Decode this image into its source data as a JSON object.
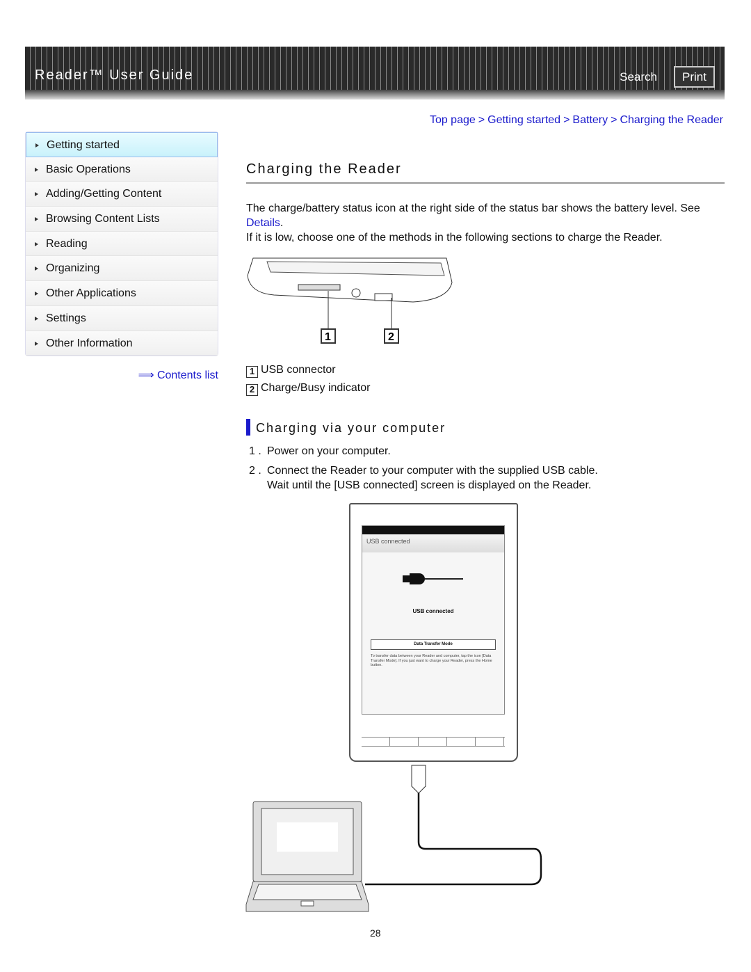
{
  "header": {
    "title": "Reader™ User Guide",
    "search": "Search",
    "print": "Print"
  },
  "breadcrumb": [
    "Top page",
    "Getting started",
    "Battery",
    "Charging the Reader"
  ],
  "breadcrumb_sep": ">",
  "sidebar": {
    "items": [
      "Getting started",
      "Basic Operations",
      "Adding/Getting Content",
      "Browsing Content Lists",
      "Reading",
      "Organizing",
      "Other Applications",
      "Settings",
      "Other Information"
    ],
    "active": 0,
    "contents_link": "Contents list"
  },
  "main": {
    "title": "Charging the Reader",
    "intro1": "The charge/battery status icon at the right side of the status bar shows the battery level. See",
    "details_link": "Details",
    "intro2": "If it is low, choose one of the methods in the following sections to charge the Reader.",
    "callouts": [
      {
        "n": "1",
        "label": "USB connector"
      },
      {
        "n": "2",
        "label": "Charge/Busy indicator"
      }
    ],
    "section_title": "Charging via your computer",
    "steps": [
      {
        "n": "1 .",
        "text": "Power on your computer."
      },
      {
        "n": "2 .",
        "text": "Connect the Reader to your computer with the supplied USB cable.",
        "sub": "Wait until the [USB connected] screen is displayed on the Reader."
      }
    ],
    "device_screen": {
      "header": "USB connected",
      "label": "USB connected",
      "button": "Data Transfer Mode",
      "note": "To transfer data between your Reader and computer, tap the icon [Data Transfer Mode]. If you just want to charge your Reader, press the Home button."
    }
  },
  "page_number": "28"
}
